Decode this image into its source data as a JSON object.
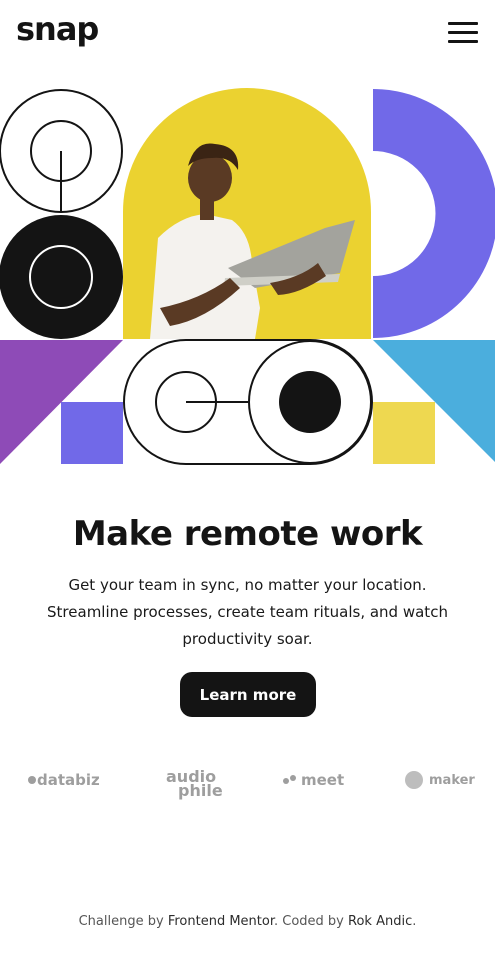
{
  "header": {
    "logo": "snap",
    "menu_icon": "hamburger-menu-icon"
  },
  "hero": {
    "image_alt": "man holding laptop",
    "colors": {
      "purple": "#7169E8",
      "violet": "#8E4BB7",
      "blue": "#4BAEDD",
      "yellow": "#EED850",
      "photo_bg": "#EBD230",
      "dark": "#141414"
    }
  },
  "main": {
    "headline": "Make remote work",
    "description": "Get your team in sync, no matter your location. Streamline processes, create team rituals, and watch productivity soar.",
    "cta_label": "Learn more"
  },
  "clients": [
    {
      "name": "databiz"
    },
    {
      "name": "audiophile",
      "line1": "audio",
      "line2": "phile"
    },
    {
      "name": "meet"
    },
    {
      "name": "maker"
    }
  ],
  "attribution": {
    "prefix": "Challenge by ",
    "link1": "Frontend Mentor",
    "middle": ". Coded by ",
    "link2": "Rok Andic",
    "suffix": "."
  }
}
